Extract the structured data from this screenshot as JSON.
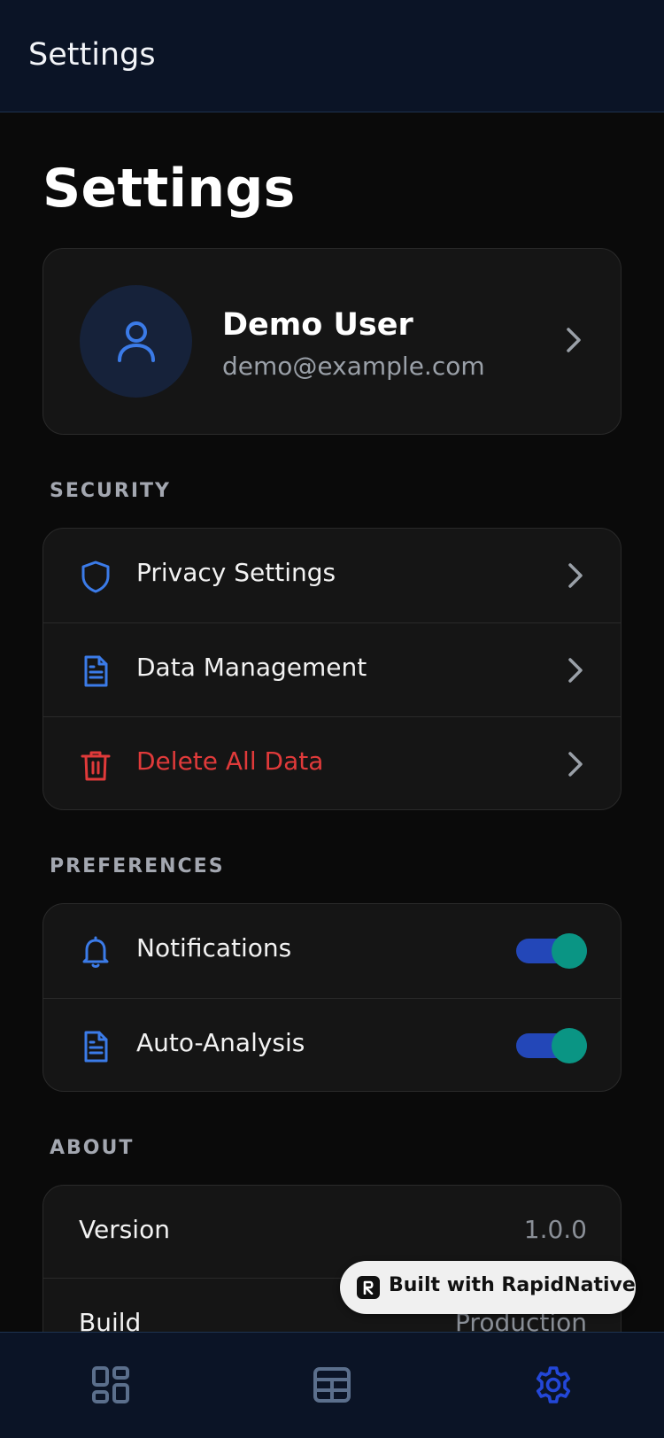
{
  "header": {
    "title": "Settings"
  },
  "page": {
    "title": "Settings"
  },
  "profile": {
    "name": "Demo User",
    "email": "demo@example.com",
    "avatar_icon": "user-icon"
  },
  "security": {
    "label": "SECURITY",
    "items": [
      {
        "label": "Privacy Settings",
        "icon": "shield-icon"
      },
      {
        "label": "Data Management",
        "icon": "document-icon"
      },
      {
        "label": "Delete All Data",
        "icon": "trash-icon",
        "color": "#e03a3a"
      }
    ]
  },
  "preferences": {
    "label": "PREFERENCES",
    "items": [
      {
        "label": "Notifications",
        "icon": "bell-icon",
        "enabled": true
      },
      {
        "label": "Auto-Analysis",
        "icon": "document-icon",
        "enabled": true
      }
    ]
  },
  "about": {
    "label": "ABOUT",
    "items": [
      {
        "label": "Version",
        "value": "1.0.0"
      },
      {
        "label": "Build",
        "value": "Production"
      }
    ]
  },
  "badge": {
    "text": "Built with RapidNative"
  },
  "tabs": [
    {
      "icon": "dashboard-icon",
      "active": false
    },
    {
      "icon": "table-icon",
      "active": false
    },
    {
      "icon": "gear-icon",
      "active": true
    }
  ],
  "colors": {
    "accent": "#3b7be8",
    "danger": "#e03a3a",
    "toggle_track": "#2347b8",
    "toggle_knob": "#0a9584",
    "tab_active": "#2347d8",
    "tab_inactive": "#5b6f8c"
  }
}
